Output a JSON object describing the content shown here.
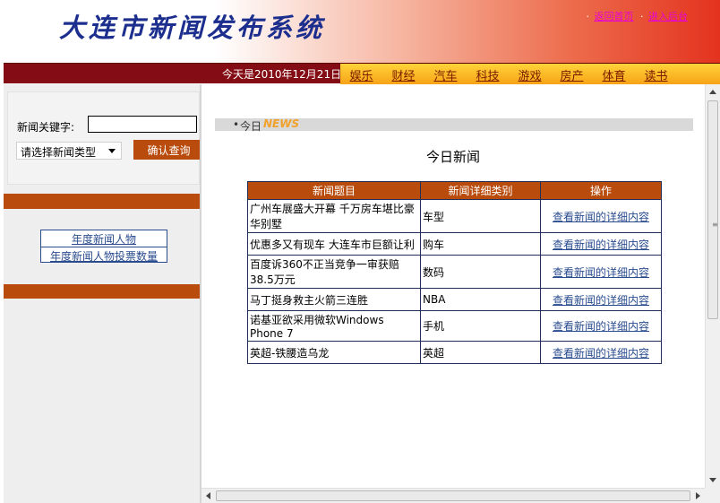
{
  "header": {
    "title": "大连市新闻发布系统",
    "link_home": "返回首页",
    "link_admin": "进入后台",
    "bullet": "·"
  },
  "navbar": {
    "date_text": "今天是2010年12月21日",
    "items": [
      "娱乐",
      "财经",
      "汽车",
      "科技",
      "游戏",
      "房产",
      "体育",
      "读书"
    ]
  },
  "sidebar": {
    "keyword_label": "新闻关键字:",
    "keyword_value": "",
    "type_select": "请选择新闻类型",
    "query_button": "确认查询",
    "links": [
      "年度新闻人物",
      "年度新闻人物投票数量"
    ]
  },
  "main": {
    "today_bullet": "•",
    "today_label": "今日",
    "today_news": "NEWS",
    "page_title": "今日新闻",
    "table": {
      "headers": [
        "新闻题目",
        "新闻详细类别",
        "操作"
      ],
      "rows": [
        {
          "title": "广州车展盛大开幕 千万房车堪比豪华别墅",
          "category": "车型",
          "action": "查看新闻的详细内容"
        },
        {
          "title": "优惠多又有现车 大连车市巨额让利",
          "category": "购车",
          "action": "查看新闻的详细内容"
        },
        {
          "title": "百度诉360不正当竞争一审获赔38.5万元",
          "category": "数码",
          "action": "查看新闻的详细内容"
        },
        {
          "title": "马丁挺身救主火箭三连胜",
          "category": "NBA",
          "action": "查看新闻的详细内容"
        },
        {
          "title": "诺基亚欲采用微软Windows Phone 7",
          "category": "手机",
          "action": "查看新闻的详细内容"
        },
        {
          "title": "英超-铁腰造乌龙",
          "category": "英超",
          "action": "查看新闻的详细内容"
        }
      ]
    }
  },
  "colors": {
    "accent": "#b94c0d",
    "nav_dark": "#840d15",
    "nav_gold": "#f7a317",
    "logo": "#1d2f8e",
    "link": "#2a4c8f"
  }
}
